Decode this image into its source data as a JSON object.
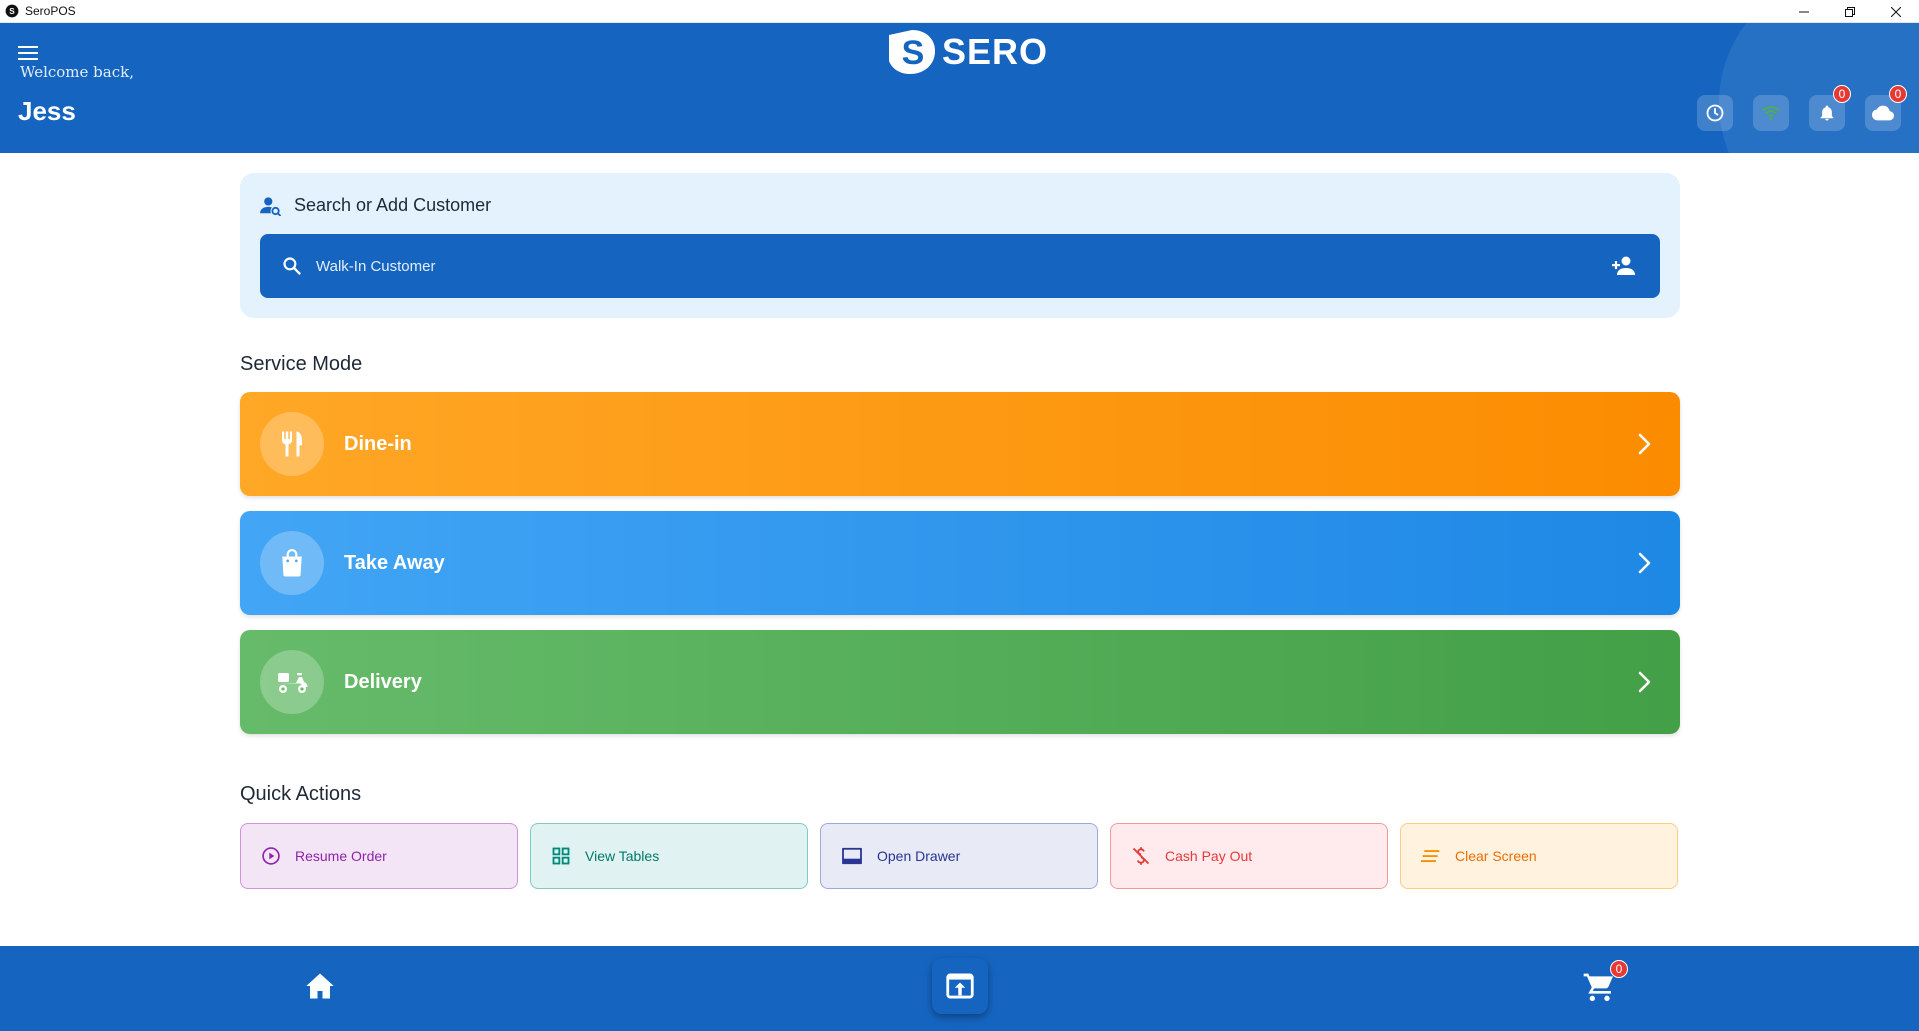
{
  "window": {
    "title": "SeroPOS"
  },
  "header": {
    "brand": "SERO",
    "welcome": "Welcome back,",
    "user_name": "Jess",
    "notifications_count": "0",
    "cloud_count": "0"
  },
  "customer": {
    "title": "Search or Add Customer",
    "placeholder": "Walk-In Customer"
  },
  "service_mode": {
    "title": "Service Mode",
    "modes": [
      {
        "label": "Dine-in",
        "icon": "utensils-icon",
        "color": "#fb8c00"
      },
      {
        "label": "Take Away",
        "icon": "shopping-bag-icon",
        "color": "#1e88e5"
      },
      {
        "label": "Delivery",
        "icon": "scooter-icon",
        "color": "#43a047"
      }
    ]
  },
  "quick_actions": {
    "title": "Quick Actions",
    "items": [
      {
        "label": "Resume Order",
        "icon": "play-circle-icon",
        "color": "#8e24aa"
      },
      {
        "label": "View Tables",
        "icon": "grid-icon",
        "color": "#00897b"
      },
      {
        "label": "Open Drawer",
        "icon": "drawer-icon",
        "color": "#283593"
      },
      {
        "label": "Cash Pay Out",
        "icon": "money-off-icon",
        "color": "#e53935"
      },
      {
        "label": "Clear Screen",
        "icon": "clear-lines-icon",
        "color": "#fb8c00"
      }
    ]
  },
  "bottom_nav": {
    "cart_count": "0"
  },
  "colors": {
    "primary": "#1565c0",
    "badge": "#e53935",
    "wifi": "#4caf50"
  }
}
